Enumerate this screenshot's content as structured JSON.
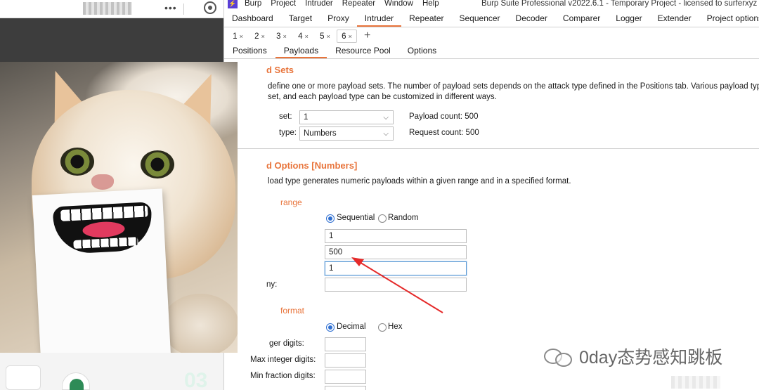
{
  "menu": {
    "logo_glyph": "⚡",
    "items": [
      "Burp",
      "Project",
      "Intruder",
      "Repeater",
      "Window",
      "Help"
    ],
    "window_title": "Burp Suite Professional v2022.6.1 - Temporary Project - licensed to surferxyz"
  },
  "main_tabs": [
    "Dashboard",
    "Target",
    "Proxy",
    "Intruder",
    "Repeater",
    "Sequencer",
    "Decoder",
    "Comparer",
    "Logger",
    "Extender",
    "Project options"
  ],
  "active_main_tab": "Intruder",
  "attack_tabs": [
    {
      "label": "1",
      "close": "×"
    },
    {
      "label": "2",
      "close": "×"
    },
    {
      "label": "3",
      "close": "×"
    },
    {
      "label": "4",
      "close": "×"
    },
    {
      "label": "5",
      "close": "×"
    },
    {
      "label": "6",
      "close": "×"
    }
  ],
  "add_tab_glyph": "+",
  "sub_tabs": [
    "Positions",
    "Payloads",
    "Resource Pool",
    "Options"
  ],
  "active_sub_tab": "Payloads",
  "payload_sets": {
    "title": "d Sets",
    "desc_line1": "define one or more payload sets. The number of payload sets depends on the attack type defined in the Positions tab. Various payload types",
    "desc_line2": "set, and each payload type can be customized in different ways.",
    "set_label": "set:",
    "set_value": "1",
    "type_label": "type:",
    "type_value": "Numbers",
    "payload_count": "Payload count: 500",
    "request_count": "Request count: 500"
  },
  "payload_options": {
    "title": "d Options [Numbers]",
    "desc": "load type generates numeric payloads within a given range and in a specified format.",
    "range_title": "range",
    "sequential_label": "Sequential",
    "random_label": "Random",
    "from_value": "1",
    "to_value": "500",
    "step_value": "1",
    "howmany_label": "ny:",
    "howmany_value": "",
    "format_title": "format",
    "decimal_label": "Decimal",
    "hex_label": "Hex",
    "min_int_label": "ger digits:",
    "max_int_label": "Max integer digits:",
    "min_frac_label": "Min fraction digits:"
  },
  "watermark": {
    "text": "0day态势感知跳板"
  },
  "colors": {
    "accent": "#e8743b",
    "arrow": "#e52a2a",
    "radio_on": "#2f6fd1"
  }
}
